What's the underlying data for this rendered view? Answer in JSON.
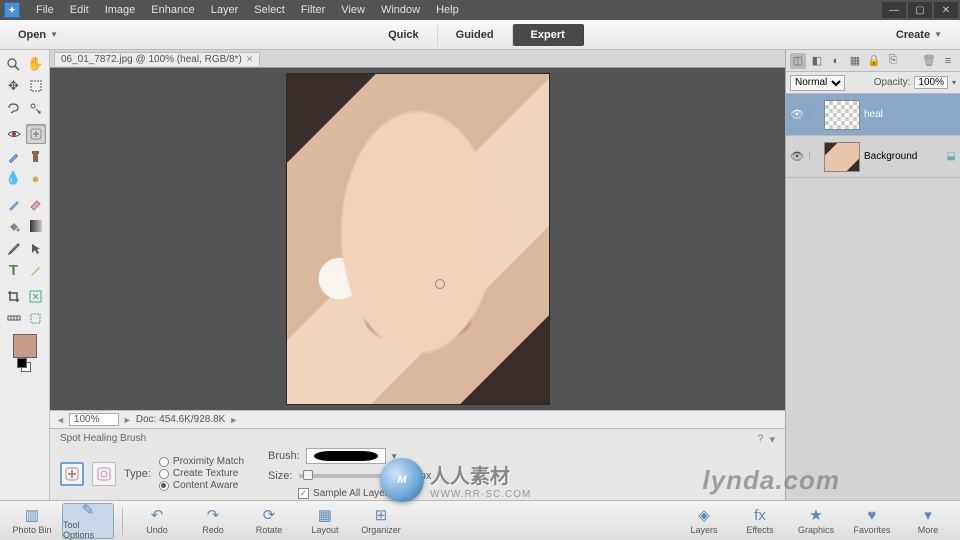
{
  "menubar": {
    "items": [
      "File",
      "Edit",
      "Image",
      "Enhance",
      "Layer",
      "Select",
      "Filter",
      "View",
      "Window",
      "Help"
    ]
  },
  "subbar": {
    "open": "Open",
    "modes": [
      "Quick",
      "Guided",
      "Expert"
    ],
    "active_mode": "Expert",
    "create": "Create"
  },
  "document": {
    "tab": "06_01_7872.jpg @ 100% (heal, RGB/8*)",
    "zoom": "100%",
    "doc_size": "Doc: 454.6K/928.8K"
  },
  "options": {
    "title": "Spot Healing Brush",
    "type_label": "Type:",
    "type_options": [
      "Proximity Match",
      "Create Texture",
      "Content Aware"
    ],
    "type_selected": "Content Aware",
    "brush_label": "Brush:",
    "size_label": "Size:",
    "size_value": "13 px",
    "sample_label": "Sample All Layers",
    "sample_checked": true,
    "brush_dropdown_arrow": "▾"
  },
  "layers_panel": {
    "blend_mode": "Normal",
    "opacity_label": "Opacity:",
    "opacity_value": "100%",
    "layers": [
      {
        "name": "heal",
        "visible": true,
        "selected": true,
        "thumb": "checker"
      },
      {
        "name": "Background",
        "visible": true,
        "selected": false,
        "thumb": "photo"
      }
    ]
  },
  "bottom_bar": {
    "left": [
      {
        "label": "Photo Bin",
        "active": false
      },
      {
        "label": "Tool Options",
        "active": true
      }
    ],
    "middle": [
      {
        "label": "Undo"
      },
      {
        "label": "Redo"
      },
      {
        "label": "Rotate"
      },
      {
        "label": "Layout"
      },
      {
        "label": "Organizer"
      }
    ],
    "right": [
      {
        "label": "Layers"
      },
      {
        "label": "Effects"
      },
      {
        "label": "Graphics"
      },
      {
        "label": "Favorites"
      },
      {
        "label": "More"
      }
    ]
  },
  "watermark": {
    "brand": "lynda.com",
    "cn": "人人素材",
    "url": "WWW.RR-SC.COM",
    "logo": "M"
  }
}
